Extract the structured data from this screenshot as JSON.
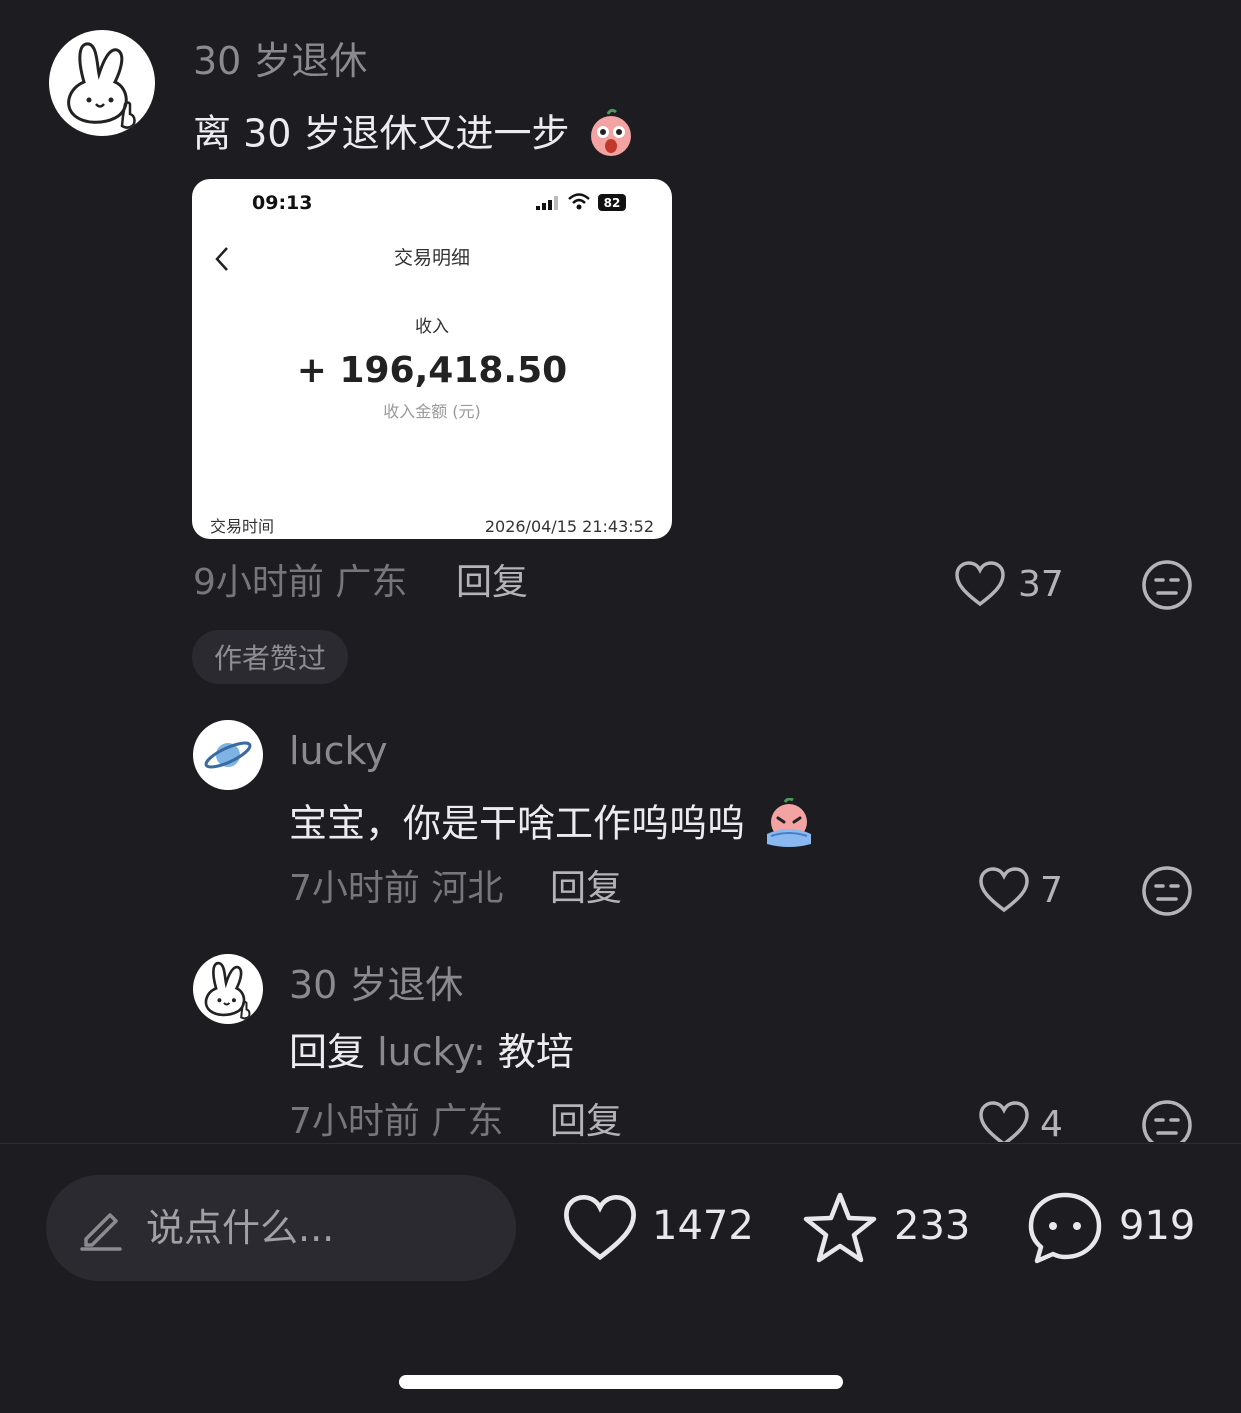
{
  "comment1": {
    "username": "30 岁退休",
    "text": "离 30 岁退休又进一步",
    "emoji": "face-emoji-surprised",
    "meta": "9小时前 广东",
    "reply": "回复",
    "likes": "37",
    "tag": "作者赞过",
    "image": {
      "time": "09:13",
      "battery": "82",
      "page_title": "交易明细",
      "income_label": "收入",
      "amount": "+ 196,418.50",
      "amount_unit": "收入金额 (元)",
      "trade_time_label": "交易时间",
      "trade_time": "2026/04/15 21:43:52"
    }
  },
  "comment2": {
    "username": "lucky",
    "text": "宝宝，你是干啥工作呜呜呜",
    "emoji": "face-emoji-crying",
    "meta": "7小时前 河北",
    "reply": "回复",
    "likes": "7"
  },
  "comment3": {
    "username": "30 岁退休",
    "text_prefix": "回复",
    "text_target": "lucky:",
    "text_body": "教培",
    "meta": "7小时前 广东",
    "reply": "回复",
    "likes": "4"
  },
  "bottom_bar": {
    "input_placeholder": "说点什么...",
    "likes": "1472",
    "favorites": "233",
    "comments": "919"
  }
}
